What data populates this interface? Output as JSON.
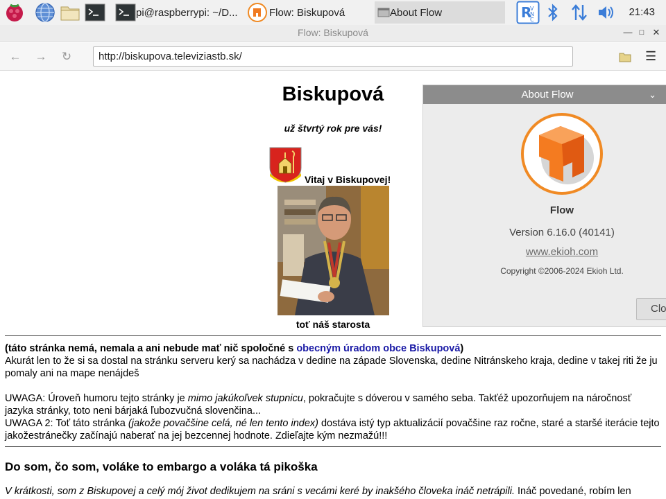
{
  "taskbar": {
    "tasks": [
      {
        "label": "pi@raspberrypi: ~/D..."
      },
      {
        "label": "Flow: Biskupová"
      },
      {
        "label": "About Flow"
      }
    ],
    "time": "21:43"
  },
  "window": {
    "title": "Flow: Biskupová"
  },
  "toolbar": {
    "url": "http://biskupova.televiziastb.sk/"
  },
  "page": {
    "title": "Biskupová",
    "tagline": "už štvrtý rok pre vás!",
    "welcome": "Vitaj v Biskupovej!",
    "caption": "toť náš starosta",
    "disclaimer_start": "(táto stránka nemá, nemala a ani nebude mať nič spoločné s ",
    "disclaimer_link": "obecným úradom obce Biskupová",
    "disclaimer_end": ")",
    "intro": "Akurát len to že si sa dostal na stránku serveru kerý sa nachádza v dedine na západe Slovenska, dedine Nitránskeho kraja, dedine v takej riti že ju pomaly ani na mape nenájdeš",
    "warning1_a": "UWAGA: Úroveň humoru tejto stránky je ",
    "warning1_em": "mimo jakúkoľvek stupnicu",
    "warning1_b": ", pokračujte s dóverou v samého seba. Takťéž upozorňujem na náročnosť jazyka stránky, toto neni bárjaká ľubozvučná slovenčina...",
    "warning2_a": "UWAGA 2: Toť táto stránka ",
    "warning2_em": "(jakože povačšine celá, né len tento index)",
    "warning2_b": " dostáva istý typ aktualizácií povačšine raz ročne, staré a staršé iterácie tejto jakožestránečky začínajú naberať na jej bezcennej hodnote. Zdieľajte kým nezmažú!!!",
    "heading": "Do som, čo som, voláke to embargo a voláka tá pikoška",
    "para_em": "V krátkosti, som z Biskupovej a celý mój život dedikujem na sráni s vecámi keré by inakšého človeka ináč netrápili.",
    "para_b": " Ináč povedané, robím len"
  },
  "about": {
    "header": "About Flow",
    "name": "Flow",
    "version": "Version 6.16.0 (40141)",
    "site": "www.ekioh.com",
    "copyright": "Copyright ©2006-2024 Ekioh Ltd.",
    "close_label": "Clo"
  }
}
